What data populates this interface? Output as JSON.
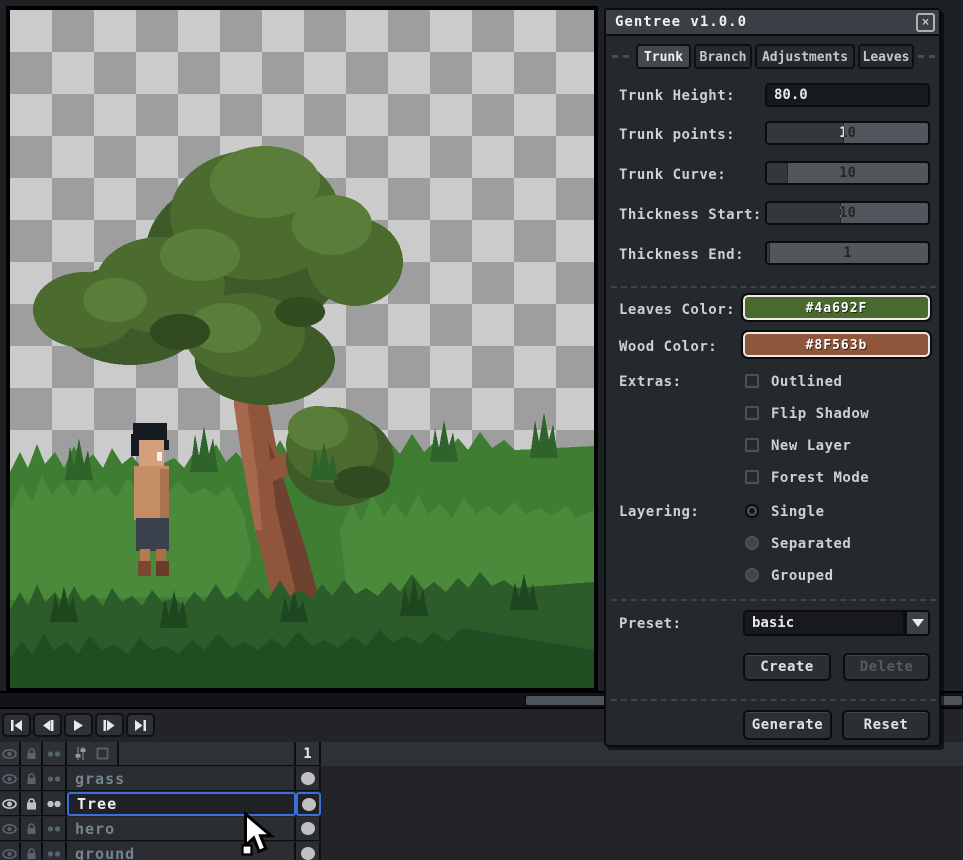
{
  "window": {
    "title": "Gentree v1.0.0",
    "close_label": "×"
  },
  "dialog": {
    "tabs": [
      {
        "label": "Trunk",
        "selected": true
      },
      {
        "label": "Branch",
        "selected": false
      },
      {
        "label": "Adjustments",
        "selected": false
      },
      {
        "label": "Leaves",
        "selected": false
      }
    ],
    "fields": {
      "trunk_height": {
        "label": "Trunk Height:",
        "value": "80.0"
      },
      "trunk_points": {
        "label": "Trunk points:",
        "value": "10",
        "fill_pct": 48
      },
      "trunk_curve": {
        "label": "Trunk Curve:",
        "value": "10",
        "fill_pct": 13
      },
      "thickness_start": {
        "label": "Thickness Start:",
        "value": "10",
        "fill_pct": 46
      },
      "thickness_end": {
        "label": "Thickness End:",
        "value": "1",
        "fill_pct": 2
      }
    },
    "colors": {
      "leaves": {
        "label": "Leaves Color:",
        "value": "#4a692F",
        "hex": "#4a692f"
      },
      "wood": {
        "label": "Wood Color:",
        "value": "#8F563b",
        "hex": "#8f563b"
      }
    },
    "extras": {
      "label": "Extras:",
      "options": [
        {
          "label": "Outlined",
          "checked": false
        },
        {
          "label": "Flip Shadow",
          "checked": false
        },
        {
          "label": "New Layer",
          "checked": false
        },
        {
          "label": "Forest Mode",
          "checked": false
        }
      ]
    },
    "layering": {
      "label": "Layering:",
      "options": [
        {
          "label": "Single",
          "selected": true
        },
        {
          "label": "Separated",
          "selected": false
        },
        {
          "label": "Grouped",
          "selected": false
        }
      ]
    },
    "preset": {
      "label": "Preset:",
      "value": "basic",
      "create_label": "Create",
      "delete_label": "Delete",
      "delete_disabled": true
    },
    "actions": {
      "generate_label": "Generate",
      "reset_label": "Reset"
    }
  },
  "timeline": {
    "frame_number": "1",
    "layers": [
      {
        "name": "grass",
        "selected": false
      },
      {
        "name": "Tree",
        "selected": true
      },
      {
        "name": "hero",
        "selected": false
      },
      {
        "name": "ground",
        "selected": false
      }
    ]
  },
  "canvas": {
    "palette": {
      "checker_light": "#cbcbcb",
      "checker_dark": "#9e9e9e",
      "leaves_base": "#4a692f",
      "leaves_dark": "#3d5a28",
      "leaves_light": "#5a7e39",
      "wood_base": "#8f563b",
      "wood_dark": "#6e4130",
      "wood_light": "#a5684a",
      "grass_mid": "#3f7d33",
      "grass_bright": "#4a8a3a",
      "grass_dark": "#2b5c29",
      "grass_darkest": "#204d22",
      "skin": "#c68e66",
      "hair": "#161a21"
    }
  }
}
